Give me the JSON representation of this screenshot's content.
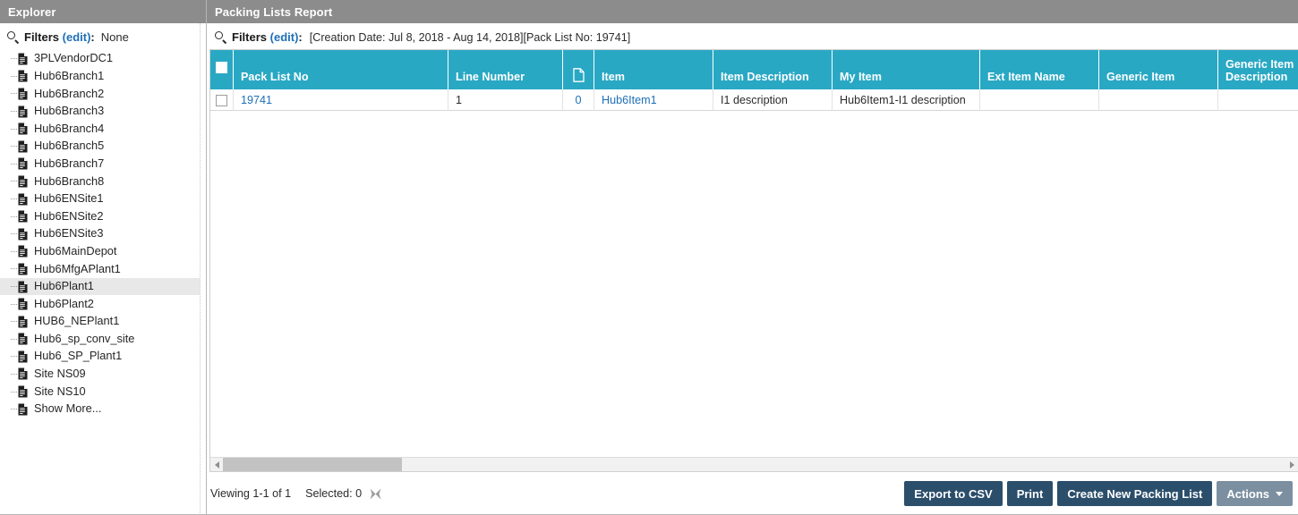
{
  "sidebar": {
    "header_title": "Explorer",
    "filters": {
      "icon": "search-icon",
      "label": "Filters",
      "edit_label": "(edit)",
      "colon": ":",
      "value": "None"
    },
    "items": [
      {
        "label": "3PLVendorDC1",
        "icon": "document-icon",
        "selected": false
      },
      {
        "label": "Hub6Branch1",
        "icon": "document-icon",
        "selected": false
      },
      {
        "label": "Hub6Branch2",
        "icon": "document-icon",
        "selected": false
      },
      {
        "label": "Hub6Branch3",
        "icon": "document-icon",
        "selected": false
      },
      {
        "label": "Hub6Branch4",
        "icon": "document-icon",
        "selected": false
      },
      {
        "label": "Hub6Branch5",
        "icon": "document-icon",
        "selected": false
      },
      {
        "label": "Hub6Branch7",
        "icon": "document-icon",
        "selected": false
      },
      {
        "label": "Hub6Branch8",
        "icon": "document-icon",
        "selected": false
      },
      {
        "label": "Hub6ENSite1",
        "icon": "document-icon",
        "selected": false
      },
      {
        "label": "Hub6ENSite2",
        "icon": "document-icon",
        "selected": false
      },
      {
        "label": "Hub6ENSite3",
        "icon": "document-icon",
        "selected": false
      },
      {
        "label": "Hub6MainDepot",
        "icon": "document-icon",
        "selected": false
      },
      {
        "label": "Hub6MfgAPlant1",
        "icon": "document-icon",
        "selected": false
      },
      {
        "label": "Hub6Plant1",
        "icon": "document-icon",
        "selected": true
      },
      {
        "label": "Hub6Plant2",
        "icon": "document-icon",
        "selected": false
      },
      {
        "label": "HUB6_NEPlant1",
        "icon": "document-icon",
        "selected": false
      },
      {
        "label": "Hub6_sp_conv_site",
        "icon": "document-icon",
        "selected": false
      },
      {
        "label": "Hub6_SP_Plant1",
        "icon": "document-icon",
        "selected": false
      },
      {
        "label": "Site NS09",
        "icon": "document-icon",
        "selected": false
      },
      {
        "label": "Site NS10",
        "icon": "document-icon",
        "selected": false
      },
      {
        "label": "Show More...",
        "icon": "document-icon",
        "selected": false
      }
    ]
  },
  "main": {
    "header_title": "Packing Lists Report",
    "filters": {
      "icon": "search-icon",
      "label": "Filters",
      "edit_label": "(edit)",
      "colon": ":",
      "value": "[Creation Date: Jul 8, 2018 - Aug 14, 2018][Pack List No: 19741]"
    },
    "table": {
      "select_all_checkbox": false,
      "columns": [
        {
          "key": "checkbox",
          "label": "",
          "type": "checkbox"
        },
        {
          "key": "pack_list_no",
          "label": "Pack List No",
          "type": "text"
        },
        {
          "key": "line_number",
          "label": "Line Number",
          "type": "text"
        },
        {
          "key": "attachment",
          "label": "",
          "type": "icon",
          "icon": "document-page-icon"
        },
        {
          "key": "item",
          "label": "Item",
          "type": "text"
        },
        {
          "key": "item_description",
          "label": "Item Description",
          "type": "text"
        },
        {
          "key": "my_item",
          "label": "My Item",
          "type": "text"
        },
        {
          "key": "ext_item_name",
          "label": "Ext Item Name",
          "type": "text"
        },
        {
          "key": "generic_item",
          "label": "Generic Item",
          "type": "text"
        },
        {
          "key": "generic_item_description",
          "label": "Generic Item Description",
          "type": "text"
        }
      ],
      "rows": [
        {
          "checkbox": false,
          "pack_list_no": "19741",
          "line_number": "1",
          "attachment": "0",
          "item": "Hub6Item1",
          "item_description": "I1 description",
          "my_item": "Hub6Item1-I1 description",
          "ext_item_name": "",
          "generic_item": "",
          "generic_item_description": ""
        }
      ]
    },
    "hscrollbar": {
      "left_arrow_icon": "triangle-left-icon",
      "right_arrow_icon": "triangle-right-icon"
    },
    "footer": {
      "viewing_text": "Viewing 1-1 of 1",
      "selected_text": "Selected: 0",
      "clear_selection_icon": "clear-selection-x-icon",
      "buttons": [
        {
          "label": "Export to CSV",
          "style": "primary",
          "name": "export-to-csv-button"
        },
        {
          "label": "Print",
          "style": "primary",
          "name": "print-button"
        },
        {
          "label": "Create New Packing List",
          "style": "primary",
          "name": "create-new-packing-list-button"
        },
        {
          "label": "Actions",
          "style": "secondary",
          "name": "actions-button",
          "caret": true
        }
      ]
    }
  },
  "colors": {
    "panel_header_bg": "#8c8c8c",
    "table_header_bg": "#29a8c4",
    "link": "#1e6fb8",
    "button_primary_bg": "#2b4e6b",
    "button_secondary_bg": "#7b8fa1",
    "selected_row_bg": "#e8e8e8"
  }
}
